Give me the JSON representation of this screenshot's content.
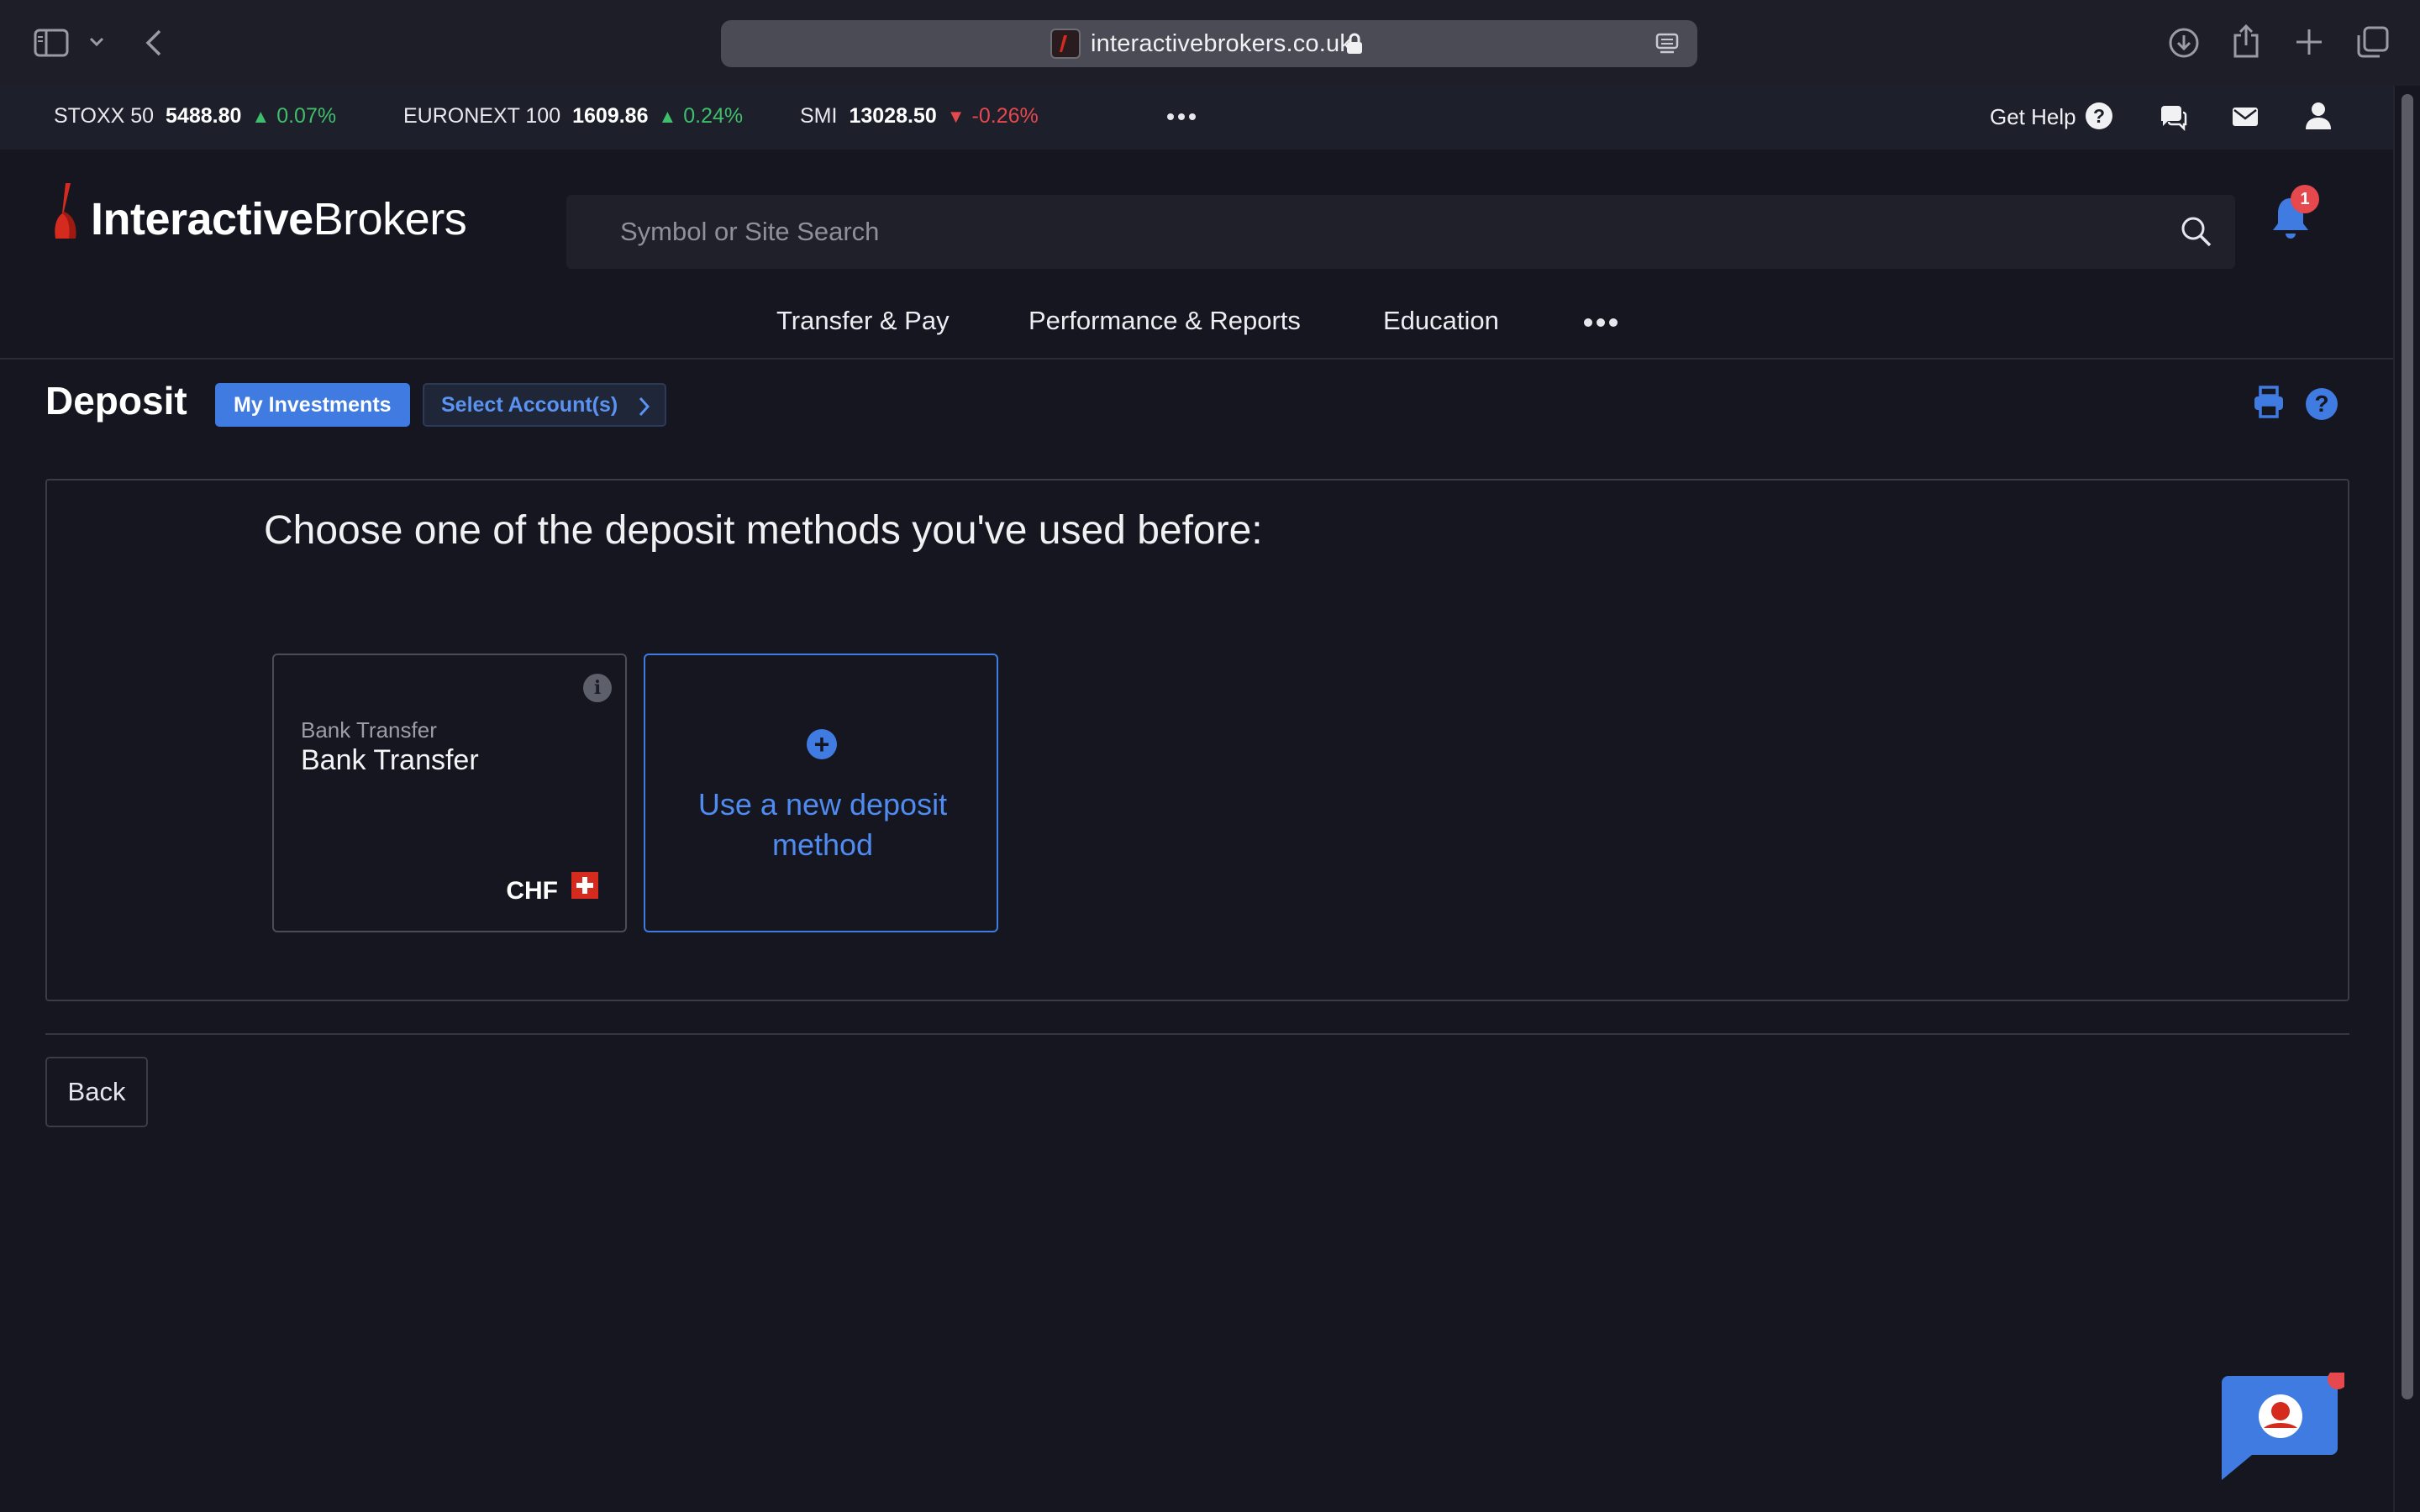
{
  "browser": {
    "url": "interactivebrokers.co.uk"
  },
  "ticker": [
    {
      "name": "STOXX 50",
      "value": "5488.80",
      "change": "0.07%",
      "direction": "up"
    },
    {
      "name": "EURONEXT 100",
      "value": "1609.86",
      "change": "0.24%",
      "direction": "up"
    },
    {
      "name": "SMI",
      "value": "13028.50",
      "change": "-0.26%",
      "direction": "down"
    }
  ],
  "topbar": {
    "get_help": "Get Help"
  },
  "header": {
    "logo_strong": "Interactive",
    "logo_light": "Brokers",
    "search_placeholder": "Symbol or Site Search",
    "notification_count": "1"
  },
  "nav": [
    {
      "label": "Transfer & Pay"
    },
    {
      "label": "Performance & Reports"
    },
    {
      "label": "Education"
    }
  ],
  "page": {
    "title": "Deposit",
    "investments_button": "My Investments",
    "accounts_button": "Select Account(s)"
  },
  "panel": {
    "heading": "Choose one of the deposit methods you've used before:",
    "cards": [
      {
        "subtitle": "Bank Transfer",
        "title": "Bank Transfer",
        "currency": "CHF"
      }
    ],
    "new_method_label": "Use a new deposit method"
  },
  "footer": {
    "back_label": "Back"
  },
  "colors": {
    "accent": "#3f7be0",
    "up": "#3fbf6b",
    "down": "#e5484d",
    "background": "#15161f"
  }
}
